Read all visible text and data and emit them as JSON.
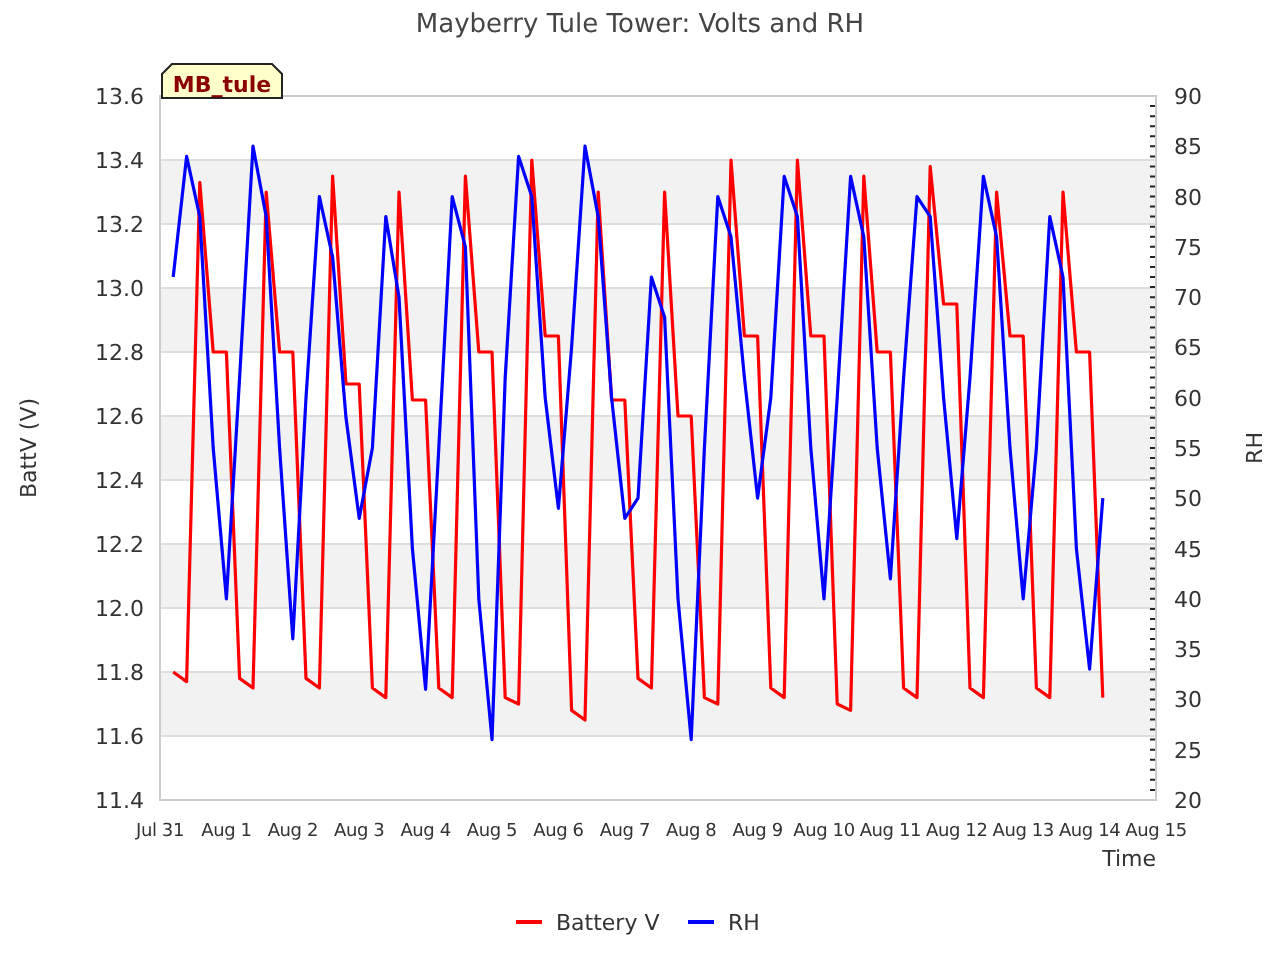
{
  "site_label": "MB_tule",
  "chart_data": {
    "type": "line",
    "title": "Mayberry Tule Tower: Volts and RH",
    "xlabel": "Time",
    "ylabel": "BattV (V)",
    "y2label": "RH",
    "grid": true,
    "legend": "bottom",
    "ylim": [
      11.4,
      13.6
    ],
    "y2lim": [
      20,
      90
    ],
    "categories": [
      "Jul 31",
      null,
      null,
      null,
      null,
      "Aug 1",
      null,
      null,
      null,
      null,
      "Aug 2",
      null,
      null,
      null,
      null,
      "Aug 3",
      null,
      null,
      null,
      null,
      "Aug 4",
      null,
      null,
      null,
      null,
      "Aug 5",
      null,
      null,
      null,
      null,
      "Aug 6",
      null,
      null,
      null,
      null,
      "Aug 7",
      null,
      null,
      null,
      null,
      "Aug 8",
      null,
      null,
      null,
      null,
      "Aug 9",
      null,
      null,
      null,
      null,
      "Aug 10",
      null,
      null,
      null,
      null,
      "Aug 11",
      null,
      null,
      null,
      null,
      "Aug 12",
      null,
      null,
      null,
      null,
      "Aug 13",
      null,
      null,
      null,
      null,
      "Aug 14",
      null,
      null,
      null,
      null,
      "Aug 15"
    ],
    "yticks": [
      {
        "value": 11.4,
        "label": "11.4"
      },
      {
        "value": 11.6,
        "label": "11.6"
      },
      {
        "value": 11.8,
        "label": "11.8"
      },
      {
        "value": 12.0,
        "label": "12.0"
      },
      {
        "value": 12.2,
        "label": "12.2"
      },
      {
        "value": 12.4,
        "label": "12.4"
      },
      {
        "value": 12.6,
        "label": "12.6"
      },
      {
        "value": 12.8,
        "label": "12.8"
      },
      {
        "value": 13.0,
        "label": "13.0"
      },
      {
        "value": 13.2,
        "label": "13.2"
      },
      {
        "value": 13.4,
        "label": "13.4"
      },
      {
        "value": 13.6,
        "label": "13.6"
      }
    ],
    "y2ticks": [
      20,
      25,
      30,
      35,
      40,
      45,
      50,
      55,
      60,
      65,
      70,
      75,
      80,
      85,
      90
    ],
    "series": [
      {
        "name": "Battery V",
        "color": "#ff0000",
        "axis": "y",
        "values": [
          null,
          11.8,
          11.77,
          13.33,
          12.8,
          12.8,
          11.78,
          11.75,
          13.3,
          12.8,
          12.8,
          11.78,
          11.75,
          13.35,
          12.7,
          12.7,
          11.75,
          11.72,
          13.3,
          12.65,
          12.65,
          11.75,
          11.72,
          13.35,
          12.8,
          12.8,
          11.72,
          11.7,
          13.4,
          12.85,
          12.85,
          11.68,
          11.65,
          13.3,
          12.65,
          12.65,
          11.78,
          11.75,
          13.3,
          12.6,
          12.6,
          11.72,
          11.7,
          13.4,
          12.85,
          12.85,
          11.75,
          11.72,
          13.4,
          12.85,
          12.85,
          11.7,
          11.68,
          13.35,
          12.8,
          12.8,
          11.75,
          11.72,
          13.38,
          12.95,
          12.95,
          11.75,
          11.72,
          13.3,
          12.85,
          12.85,
          11.75,
          11.72,
          13.3,
          12.8,
          12.8,
          11.72,
          null,
          null,
          null,
          null
        ]
      },
      {
        "name": "RH",
        "color": "#0000ff",
        "axis": "y2",
        "values": [
          null,
          72,
          84,
          78,
          55,
          40,
          62,
          85,
          78,
          55,
          36,
          60,
          80,
          74,
          58,
          48,
          55,
          78,
          70,
          45,
          31,
          55,
          80,
          75,
          40,
          26,
          62,
          84,
          80,
          60,
          49,
          65,
          85,
          78,
          60,
          48,
          50,
          72,
          68,
          40,
          26,
          55,
          80,
          76,
          62,
          50,
          60,
          82,
          78,
          55,
          40,
          60,
          82,
          76,
          55,
          42,
          62,
          80,
          78,
          60,
          46,
          62,
          82,
          76,
          55,
          40,
          55,
          78,
          72,
          45,
          33,
          50,
          null,
          null,
          null,
          null
        ]
      }
    ]
  }
}
